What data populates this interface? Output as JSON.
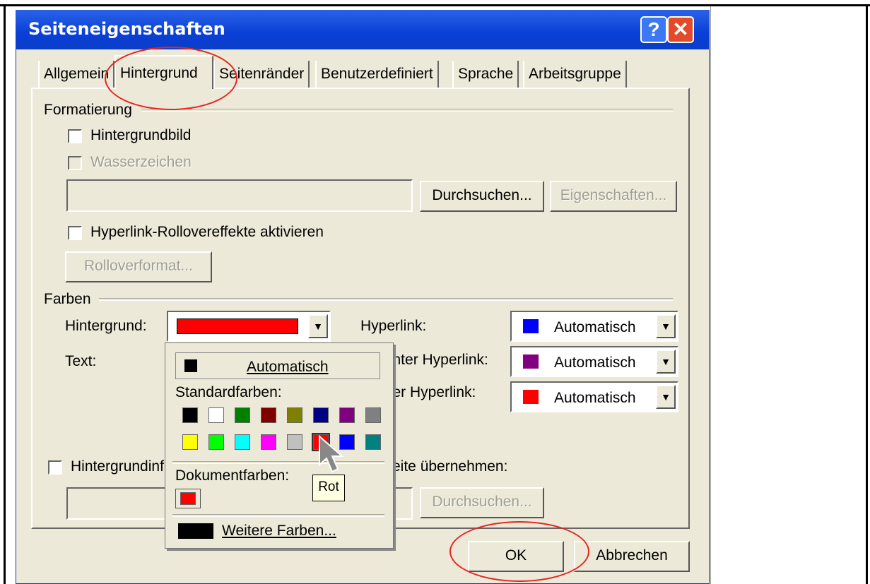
{
  "dialog": {
    "title": "Seiteneigenschaften",
    "help_glyph": "?",
    "close_glyph": "✕"
  },
  "tabs": [
    {
      "label": "Allgemein"
    },
    {
      "label": "Hintergrund",
      "active": true
    },
    {
      "label": "Seitenränder"
    },
    {
      "label": "Benutzerdefiniert"
    },
    {
      "label": "Sprache"
    },
    {
      "label": "Arbeitsgruppe"
    }
  ],
  "formatierung": {
    "heading": "Formatierung",
    "hintergrundbild_label": "Hintergrundbild",
    "wasserzeichen_label": "Wasserzeichen",
    "path_value": "",
    "browse_label": "Durchsuchen...",
    "properties_label": "Eigenschaften...",
    "rollover_label": "Hyperlink-Rollovereffekte aktivieren",
    "rolloverformat_label": "Rolloverformat..."
  },
  "farben": {
    "heading": "Farben",
    "hintergrund_label": "Hintergrund:",
    "hintergrund_color": "#ff0000",
    "text_label": "Text:",
    "hyperlink_label": "Hyperlink:",
    "hyperlink_value": "Automatisch",
    "hyperlink_color": "#0000ff",
    "visited_label": "chter Hyperlink:",
    "visited_value": "Automatisch",
    "visited_color": "#800080",
    "active_label": "ver Hyperlink:",
    "active_value": "Automatisch",
    "active_color": "#ff0000",
    "dropdown_arrow": "▼"
  },
  "copy_section": {
    "checkbox_label": "Hintergrundinf",
    "suffix_label": "eite übernehmen:",
    "browse_label": "Durchsuchen..."
  },
  "color_dropdown": {
    "automatic_label": "Automatisch",
    "standard_heading": "Standardfarben:",
    "palette_row1": [
      "#000000",
      "#ffffff",
      "#008000",
      "#800000",
      "#808000",
      "#000080",
      "#800080",
      "#808080"
    ],
    "palette_row2": [
      "#ffff00",
      "#00ff00",
      "#00ffff",
      "#ff00ff",
      "#c0c0c0",
      "#ff0000",
      "#0000ff",
      "#008080"
    ],
    "document_heading": "Dokumentfarben:",
    "document_color": "#ff0000",
    "more_colors_label": "Weitere Farben...",
    "tooltip": "Rot"
  },
  "footer": {
    "ok_label": "OK",
    "cancel_label": "Abbrechen"
  }
}
